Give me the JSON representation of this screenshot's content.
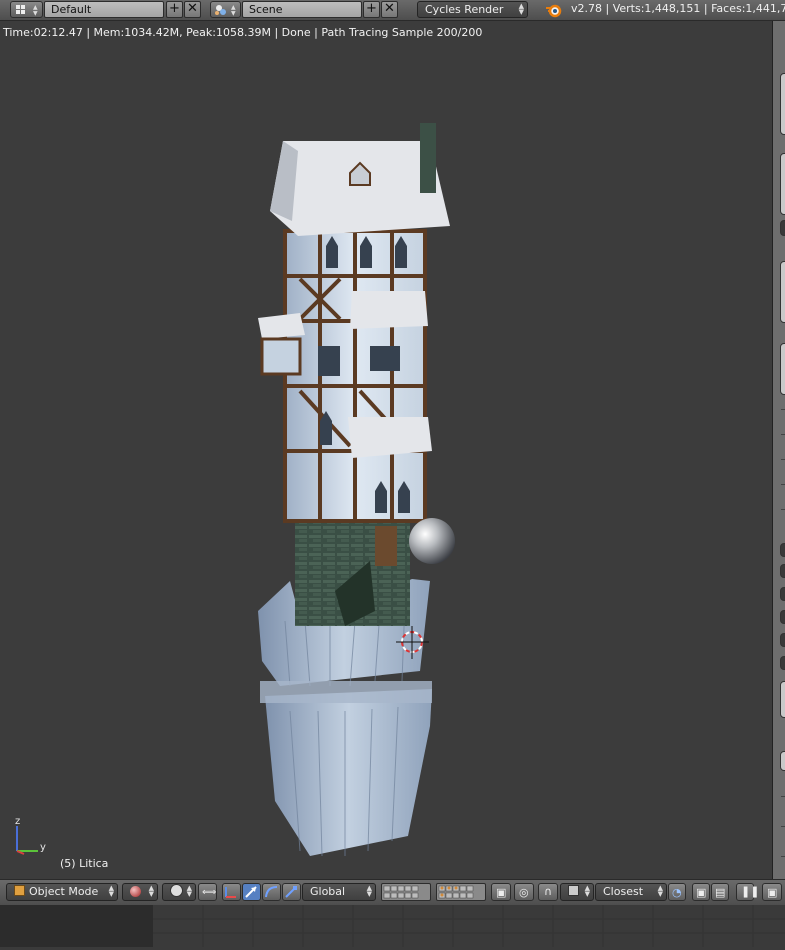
{
  "top_header": {
    "layout_name": "Default",
    "scene_name": "Scene",
    "render_engine": "Cycles Render",
    "version_stats": "v2.78 | Verts:1,448,151 | Faces:1,441,76"
  },
  "viewport": {
    "render_status": "Time:02:12.47 | Mem:1034.42M, Peak:1058.39M | Done | Path Tracing Sample 200/200",
    "object_name": "(5) Litica",
    "axis_labels": {
      "z": "z",
      "y": "y"
    }
  },
  "bottom_header": {
    "mode": "Object Mode",
    "orientation": "Global",
    "snap_target": "Closest"
  },
  "colors": {
    "header_bg": "#595959",
    "viewport_bg": "#3c3c3c",
    "accent_blue": "#5680c2"
  },
  "icons": [
    "editor-type-icon",
    "layout-icon",
    "add-icon",
    "close-icon",
    "scene-icon",
    "blender-logo-icon",
    "mode-cube-icon",
    "shading-sphere-icon",
    "pivot-icon",
    "manipulator-icon",
    "translate-icon",
    "rotate-icon",
    "scale-icon",
    "layers-icon",
    "proportional-edit-icon",
    "snap-icon",
    "render-icon",
    "clapper-icon"
  ]
}
